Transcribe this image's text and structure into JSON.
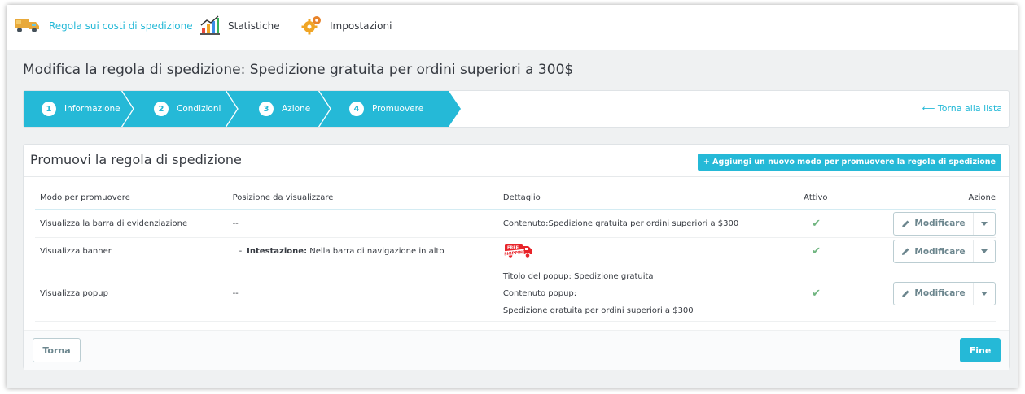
{
  "tabs": [
    {
      "label": "Regola sui costi di spedizione",
      "icon": "delivery-truck-icon"
    },
    {
      "label": "Statistiche",
      "icon": "bar-chart-icon"
    },
    {
      "label": "Impostazioni",
      "icon": "gears-icon"
    }
  ],
  "page_title": "Modifica la regola di spedizione: Spedizione gratuita per ordini superiori a 300$",
  "wizard": {
    "steps": [
      {
        "num": "1",
        "label": "Informazione"
      },
      {
        "num": "2",
        "label": "Condizioni"
      },
      {
        "num": "3",
        "label": "Azione"
      },
      {
        "num": "4",
        "label": "Promuovere"
      }
    ],
    "back_link": "⟵ Torna alla lista"
  },
  "panel": {
    "title": "Promuovi la regola di spedizione",
    "add_button": "+ Aggiungi un nuovo modo per promuovere la regola di spedizione",
    "columns": [
      "Modo per promuovere",
      "Posizione da visualizzare",
      "Dettaglio",
      "Attivo",
      "Azione"
    ],
    "rows": [
      {
        "mode": "Visualizza la barra di evidenziazione",
        "position": "--",
        "detail": "Contenuto:Spedizione gratuita per ordini superiori a $300",
        "active": "✔",
        "action": "Modificare"
      },
      {
        "mode": "Visualizza banner",
        "position_prefix": "-",
        "position_bold": "Intestazione:",
        "position_text": " Nella barra di navigazione in alto",
        "detail_image": "free-shipping-banner-icon",
        "banner_text_top": "FREE",
        "banner_text_bottom": "SHIPPING",
        "active": "✔",
        "action": "Modificare"
      },
      {
        "mode": "Visualizza popup",
        "position": "--",
        "detail_lines": [
          "Titolo del popup: Spedizione gratuita",
          "Contenuto popup:",
          "Spedizione gratuita per ordini superiori a $300"
        ],
        "active": "✔",
        "action": "Modificare"
      }
    ],
    "back_button": "Torna",
    "finish_button": "Fine"
  },
  "colors": {
    "accent": "#25b9d7",
    "check": "#70b580",
    "text": "#363a41",
    "banner_red": "#e8242a"
  }
}
